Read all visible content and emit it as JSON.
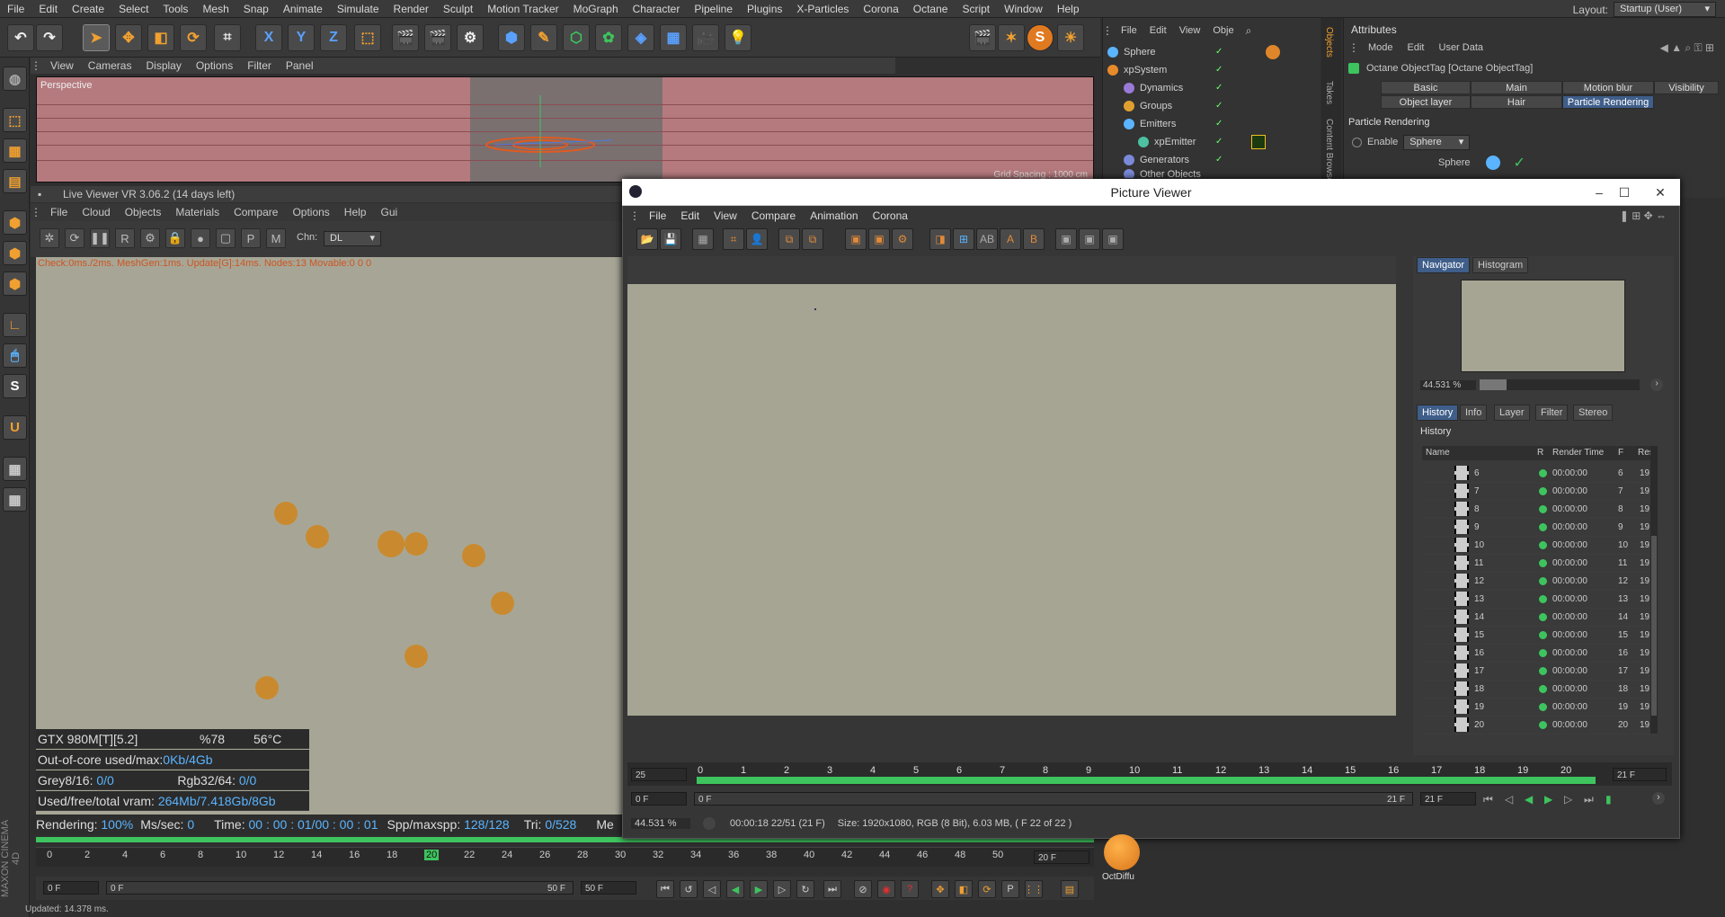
{
  "menubar": {
    "items": [
      "File",
      "Edit",
      "Create",
      "Select",
      "Tools",
      "Mesh",
      "Snap",
      "Animate",
      "Simulate",
      "Render",
      "Sculpt",
      "Motion Tracker",
      "MoGraph",
      "Character",
      "Pipeline",
      "Plugins",
      "X-Particles",
      "Corona",
      "Octane",
      "Script",
      "Window",
      "Help"
    ],
    "layout_label": "Layout:",
    "layout_value": "Startup (User)"
  },
  "viewport": {
    "menu": [
      "View",
      "Cameras",
      "Display",
      "Options",
      "Filter",
      "Panel"
    ],
    "label": "Perspective",
    "grid_spacing": "Grid Spacing : 1000 cm"
  },
  "live_viewer": {
    "title": "Live Viewer VR 3.06.2 (14 days left)",
    "menu": [
      "File",
      "Cloud",
      "Objects",
      "Materials",
      "Compare",
      "Options",
      "Help",
      "Gui"
    ],
    "channel_label": "Chn:",
    "channel_value": "DL",
    "status_line": "Check:0ms./2ms. MeshGen:1ms. Update[G]:14ms. Nodes:13 Movable:0  0 0",
    "gpu": "GTX 980M[T][5.2]",
    "gpu_usage": "%78",
    "gpu_temp": "56°C",
    "ooc_label": "Out-of-core used/max:",
    "ooc_value": "0Kb/4Gb",
    "grey_label": "Grey8/16:",
    "grey_value": "0/0",
    "rgb_label": "Rgb32/64:",
    "rgb_value": "0/0",
    "vram_label": "Used/free/total vram:",
    "vram_value": "264Mb/7.418Gb/8Gb",
    "rendering_label": "Rendering:",
    "rendering_value": "100%",
    "mssec_label": "Ms/sec:",
    "mssec_value": "0",
    "time_label": "Time:",
    "time_value": "00 : 00 : 01/00 : 00 : 01",
    "spp_label": "Spp/maxspp:",
    "spp_value": "128/128",
    "tri_label": "Tri:",
    "tri_value": "0/528",
    "mesh_label": "Me"
  },
  "timeline": {
    "ticks": [
      "0",
      "2",
      "4",
      "6",
      "8",
      "10",
      "12",
      "14",
      "16",
      "18",
      "20",
      "22",
      "24",
      "26",
      "28",
      "30",
      "32",
      "34",
      "36",
      "38",
      "40",
      "42",
      "44",
      "46",
      "48",
      "50"
    ],
    "current": "20",
    "end_field": "20 F",
    "start_field": "0 F",
    "range_start": "0 F",
    "range_end": "50 F",
    "max_field": "50 F"
  },
  "status_bar": "Updated: 14.378 ms.",
  "objects": {
    "menu": [
      "File",
      "Edit",
      "View",
      "Obje"
    ],
    "items": [
      {
        "name": "Sphere",
        "color": "#5ab4ff"
      },
      {
        "name": "xpSystem",
        "color": "#e88a2a"
      },
      {
        "name": "Dynamics",
        "color": "#9a7ad8"
      },
      {
        "name": "Groups",
        "color": "#e0a030"
      },
      {
        "name": "Emitters",
        "color": "#5ab4ff"
      },
      {
        "name": "xpEmitter",
        "color": "#4cc0a0"
      },
      {
        "name": "Generators",
        "color": "#7a8ad8"
      },
      {
        "name": "Other Objects",
        "color": "#7a8ad8"
      }
    ],
    "side_tabs": [
      "Objects",
      "Takes",
      "Content Browser"
    ]
  },
  "attributes": {
    "title": "Attributes",
    "menu": [
      "Mode",
      "Edit",
      "User Data"
    ],
    "object_title": "Octane ObjectTag [Octane ObjectTag]",
    "tabs_row1": [
      "Basic",
      "Main",
      "Motion blur",
      "Visibility"
    ],
    "tabs_row2": [
      "Object layer",
      "Hair",
      "Particle Rendering"
    ],
    "active_tab": "Particle Rendering",
    "section": "Particle Rendering",
    "enable_label": "Enable",
    "enable_value": "Sphere",
    "sphere_label": "Sphere"
  },
  "picture_viewer": {
    "title": "Picture Viewer",
    "menu": [
      "File",
      "Edit",
      "View",
      "Compare",
      "Animation",
      "Corona"
    ],
    "nav_tabs": [
      "Navigator",
      "Histogram"
    ],
    "zoom": "44.531 %",
    "hist_tabs": [
      "History",
      "Info",
      "Layer",
      "Filter",
      "Stereo"
    ],
    "history_title": "History",
    "columns": [
      "Name",
      "R",
      "Render Time",
      "F",
      "Res"
    ],
    "rows": [
      {
        "n": "6",
        "t": "00:00:00",
        "f": "6",
        "r": "19"
      },
      {
        "n": "7",
        "t": "00:00:00",
        "f": "7",
        "r": "19"
      },
      {
        "n": "8",
        "t": "00:00:00",
        "f": "8",
        "r": "19"
      },
      {
        "n": "9",
        "t": "00:00:00",
        "f": "9",
        "r": "19"
      },
      {
        "n": "10",
        "t": "00:00:00",
        "f": "10",
        "r": "19"
      },
      {
        "n": "11",
        "t": "00:00:00",
        "f": "11",
        "r": "19"
      },
      {
        "n": "12",
        "t": "00:00:00",
        "f": "12",
        "r": "19"
      },
      {
        "n": "13",
        "t": "00:00:00",
        "f": "13",
        "r": "19"
      },
      {
        "n": "14",
        "t": "00:00:00",
        "f": "14",
        "r": "19"
      },
      {
        "n": "15",
        "t": "00:00:00",
        "f": "15",
        "r": "19"
      },
      {
        "n": "16",
        "t": "00:00:00",
        "f": "16",
        "r": "19"
      },
      {
        "n": "17",
        "t": "00:00:00",
        "f": "17",
        "r": "19"
      },
      {
        "n": "18",
        "t": "00:00:00",
        "f": "18",
        "r": "19"
      },
      {
        "n": "19",
        "t": "00:00:00",
        "f": "19",
        "r": "19"
      },
      {
        "n": "20",
        "t": "00:00:00",
        "f": "20",
        "r": "19"
      }
    ],
    "fps": "25",
    "frame_ticks": [
      "0",
      "1",
      "2",
      "3",
      "4",
      "5",
      "6",
      "7",
      "8",
      "9",
      "10",
      "11",
      "12",
      "13",
      "14",
      "15",
      "16",
      "17",
      "18",
      "19",
      "20"
    ],
    "end_frame": "21 F",
    "start_frame": "0 F",
    "range_start": "0 F",
    "range_end": "21 F",
    "range_field": "21 F",
    "status_zoom": "44.531 %",
    "status_time": "00:00:18 22/51 (21 F)",
    "status_info": "Size: 1920x1080, RGB (8 Bit), 6.03 MB,  ( F 22 of 22 )"
  },
  "bottom_material": "OctDiffu"
}
